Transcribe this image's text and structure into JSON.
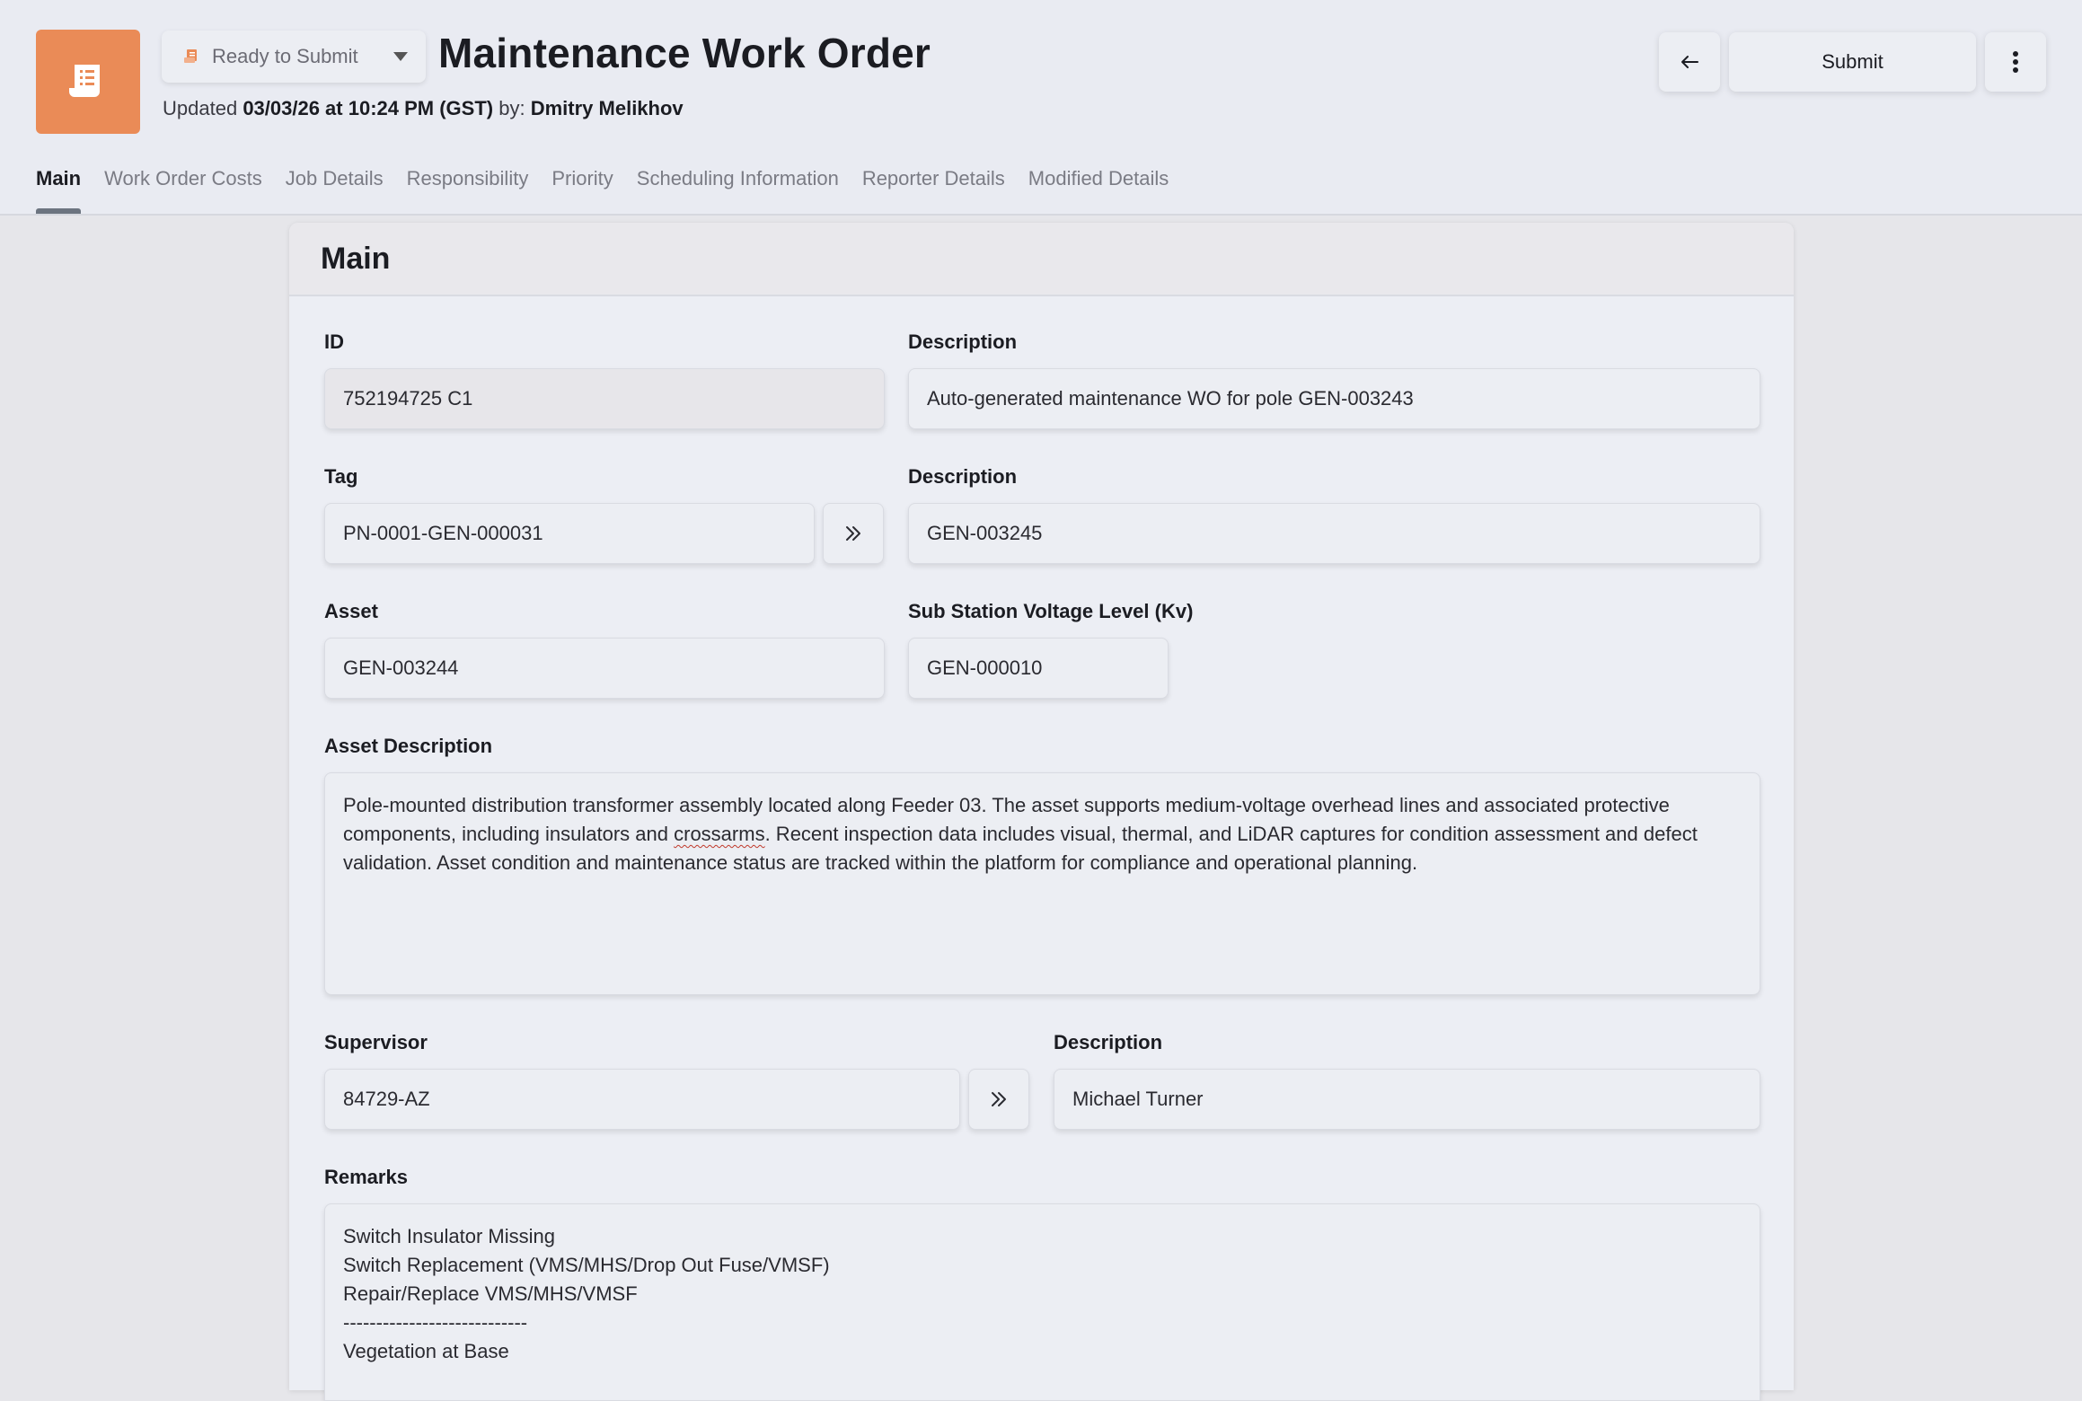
{
  "header": {
    "status": "Ready to Submit",
    "title": "Maintenance Work Order",
    "updated_prefix": "Updated",
    "updated_datetime": "03/03/26 at 10:24 PM (GST)",
    "updated_by_label": "by:",
    "updated_by": "Dmitry Melikhov",
    "submit_label": "Submit",
    "app_icon": "receipt-icon",
    "accent_color": "#ea8b57"
  },
  "tabs": [
    {
      "label": "Main",
      "active": true
    },
    {
      "label": "Work Order Costs"
    },
    {
      "label": "Job Details"
    },
    {
      "label": "Responsibility"
    },
    {
      "label": "Priority"
    },
    {
      "label": "Scheduling Information"
    },
    {
      "label": "Reporter Details"
    },
    {
      "label": "Modified Details"
    }
  ],
  "card": {
    "title": "Main",
    "fields": {
      "id": {
        "label": "ID",
        "value": "752194725 C1"
      },
      "description": {
        "label": "Description",
        "value": "Auto-generated maintenance WO for pole GEN-003243"
      },
      "tag": {
        "label": "Tag",
        "value": "PN-0001-GEN-000031"
      },
      "tag_description": {
        "label": "Description",
        "value": "GEN-003245"
      },
      "asset": {
        "label": "Asset",
        "value": "GEN-003244"
      },
      "voltage": {
        "label": "Sub Station Voltage Level (Kv)",
        "value": "GEN-000010"
      },
      "asset_description": {
        "label": "Asset Description",
        "value_part1": "Pole-mounted distribution transformer assembly located along Feeder 03. The asset supports medium-voltage overhead lines and associated protective components, including insulators and ",
        "value_misspelled": "crossarms",
        "value_part2": ". Recent inspection data includes visual, thermal, and LiDAR captures for condition assessment and defect validation. Asset condition and maintenance status are tracked within the platform for compliance and operational planning."
      },
      "supervisor": {
        "label": "Supervisor",
        "value": "84729-AZ"
      },
      "supervisor_description": {
        "label": "Description",
        "value": "Michael Turner"
      },
      "remarks": {
        "label": "Remarks",
        "lines": [
          "Switch Insulator Missing",
          "Switch Replacement (VMS/MHS/Drop Out Fuse/VMSF)",
          "Repair/Replace VMS/MHS/VMSF",
          "----------------------------",
          "Vegetation at Base"
        ]
      }
    }
  }
}
